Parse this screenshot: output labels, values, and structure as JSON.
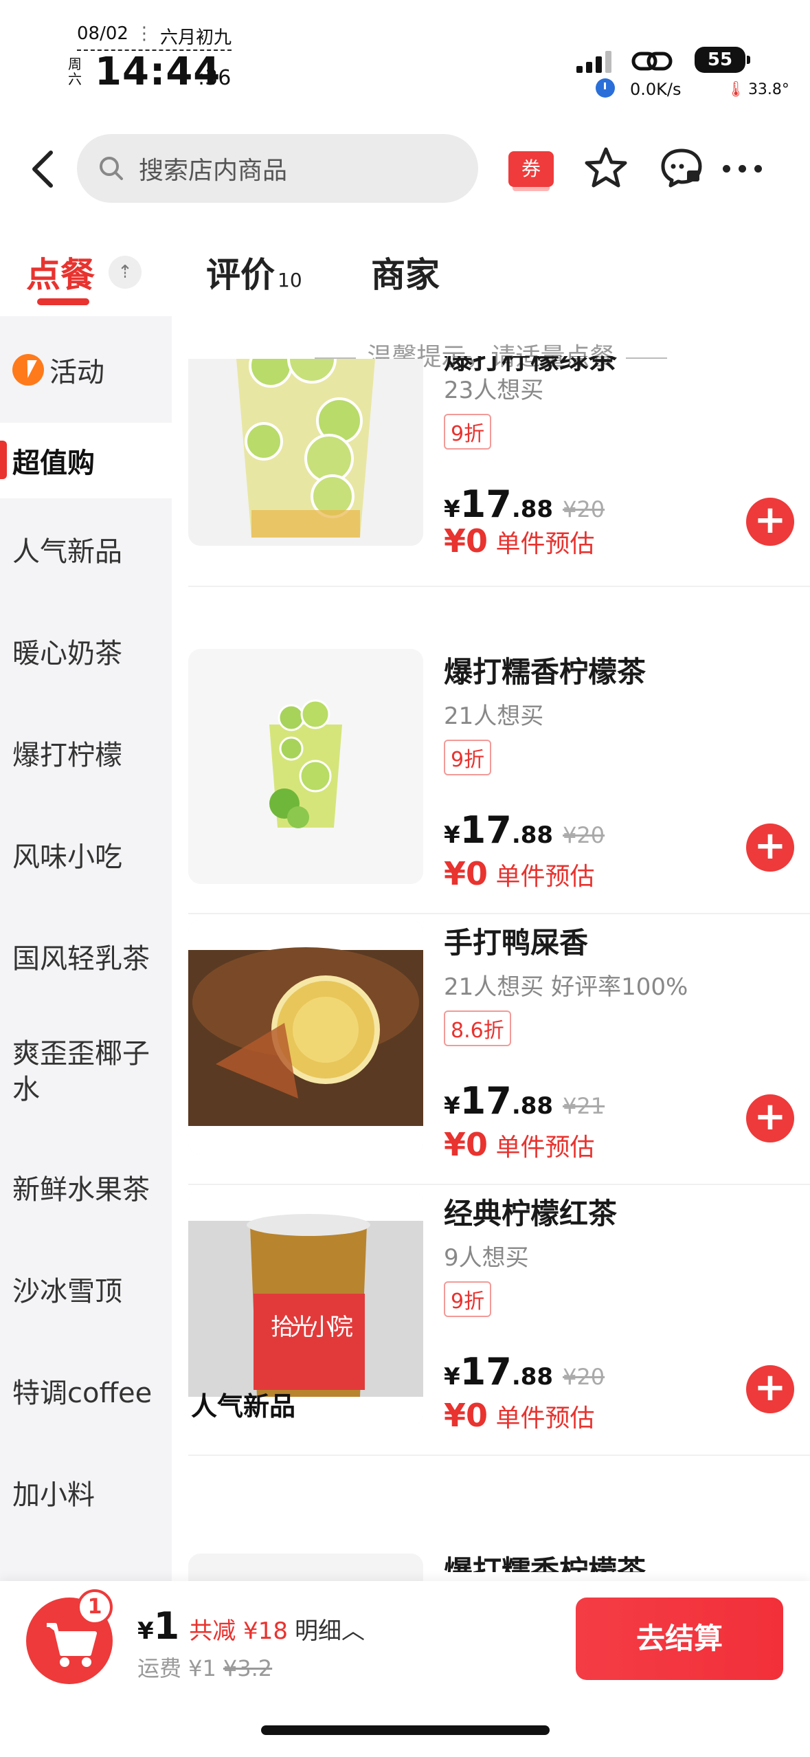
{
  "status_bar": {
    "date": "08/02",
    "lunar": "六月初九",
    "weekday": "周六",
    "time": "14:44",
    "seconds": ":36",
    "battery": "55",
    "net_speed": "0.0K/s",
    "temperature": "33.8°"
  },
  "top_nav": {
    "search_placeholder": "搜索店内商品",
    "coupon_label": "券"
  },
  "tabs": {
    "order": "点餐",
    "reviews": "评价",
    "reviews_count": "10",
    "merchant": "商家"
  },
  "sidebar": {
    "items": [
      "活动",
      "超值购",
      "人气新品",
      "暖心奶茶",
      "爆打柠檬",
      "风味小吃",
      "国风轻乳茶",
      "爽歪歪椰子水",
      "新鲜水果茶",
      "沙冰雪顶",
      "特调coffee",
      "加小料"
    ],
    "active_index": 1
  },
  "content": {
    "tip": "温馨提示，请适量点餐",
    "products": [
      {
        "name": "爆打柠檬绿茶",
        "want": "23人想买",
        "discount": "9折",
        "price_int": "17",
        "price_dec": ".88",
        "orig_price": "¥20",
        "est_amount": "0",
        "est_label": "单件预估"
      },
      {
        "name": "爆打糯香柠檬茶",
        "want": "21人想买",
        "discount": "9折",
        "price_int": "17",
        "price_dec": ".88",
        "orig_price": "¥20",
        "est_amount": "0",
        "est_label": "单件预估"
      },
      {
        "name": "手打鸭屎香",
        "want": "21人想买 好评率100%",
        "discount": "8.6折",
        "price_int": "17",
        "price_dec": ".88",
        "orig_price": "¥21",
        "est_amount": "0",
        "est_label": "单件预估"
      },
      {
        "name": "经典柠檬红茶",
        "want": "9人想买",
        "discount": "9折",
        "price_int": "17",
        "price_dec": ".88",
        "orig_price": "¥20",
        "est_amount": "0",
        "est_label": "单件预估"
      }
    ],
    "currency": "¥",
    "section_title": "人气新品",
    "peek_name": "爆打糯香柠檬茶",
    "cup_print": "拾光小院"
  },
  "bottom_bar": {
    "cart_count": "1",
    "currency": "¥",
    "total": "1",
    "saving": "共减 ¥18",
    "detail": "明细︿",
    "fee_label": "运费 ¥1",
    "fee_orig": "¥3.2",
    "checkout": "去结算"
  },
  "colors": {
    "accent": "#e8332f",
    "sidebar_bg": "#f4f4f6",
    "search_bg": "#ebebeb"
  }
}
